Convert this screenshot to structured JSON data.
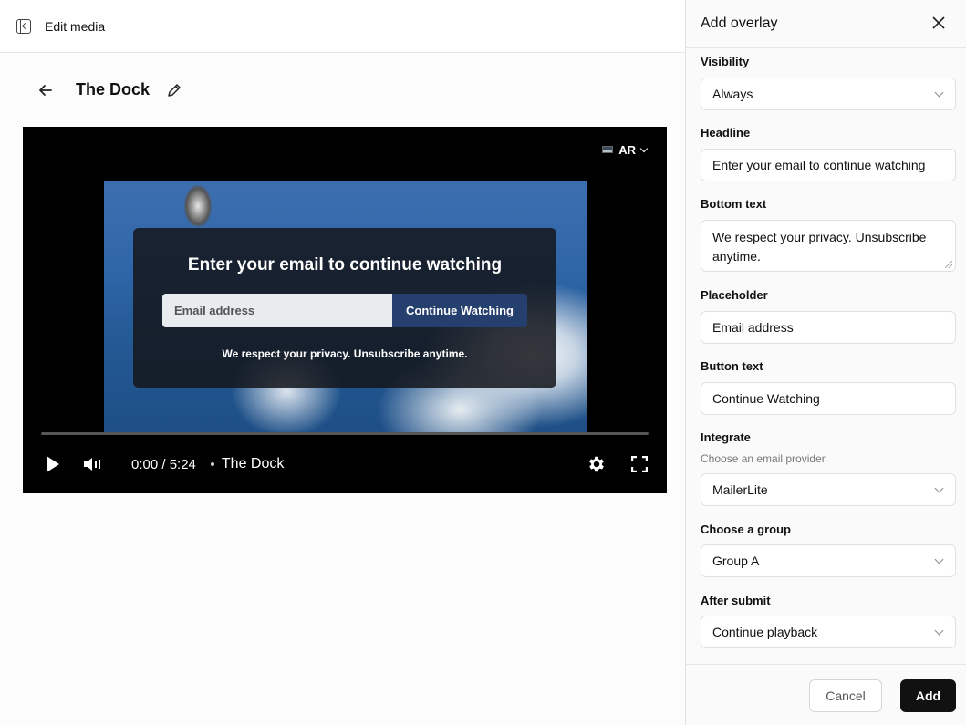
{
  "topbar": {
    "title": "Edit media"
  },
  "media": {
    "title": "The Dock"
  },
  "player": {
    "language": "AR",
    "overlay": {
      "headline": "Enter your email to continue watching",
      "placeholder": "Email address",
      "button_text": "Continue Watching",
      "bottom_text": "We respect your privacy. Unsubscribe anytime."
    },
    "time": "0:00 / 5:24",
    "video_name": "The Dock",
    "progress": 0
  },
  "panel": {
    "title": "Add overlay",
    "visibility": {
      "label": "Visibility",
      "value": "Always"
    },
    "headline": {
      "label": "Headline",
      "value": "Enter your email to continue watching"
    },
    "bottom_text": {
      "label": "Bottom text",
      "value": "We respect your privacy. Unsubscribe anytime."
    },
    "placeholder": {
      "label": "Placeholder",
      "value": "Email address"
    },
    "button_text": {
      "label": "Button text",
      "value": "Continue Watching"
    },
    "integrate": {
      "label": "Integrate",
      "sublabel": "Choose an email provider",
      "value": "MailerLite"
    },
    "group": {
      "label": "Choose a group",
      "value": "Group A"
    },
    "after_submit": {
      "label": "After submit",
      "value": "Continue playback"
    },
    "cancel_label": "Cancel",
    "add_label": "Add"
  }
}
